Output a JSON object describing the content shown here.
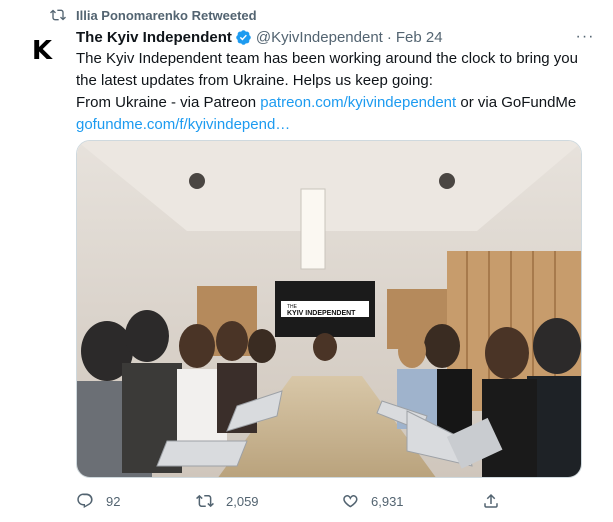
{
  "retweet": {
    "label": "Illia Ponomarenko Retweeted",
    "icon": "retweet-icon"
  },
  "avatar": {
    "letter": "K"
  },
  "tweet": {
    "author_name": "The Kyiv Independent",
    "verified": true,
    "handle": "@KyivIndependent",
    "separator": "·",
    "date": "Feb 24",
    "more_label": "···",
    "line1": "The Kyiv Independent team has been working around the clock to bring you",
    "line2": "the latest updates from Ukraine. Helps us keep going:",
    "line3_prefix": "From Ukraine - via Patreon ",
    "link_patreon": "patreon.com/kyivindependent",
    "line3_mid": " or via GoFundMe",
    "link_gofundme": "gofundme.com/f/kyivindepend…"
  },
  "media": {
    "screen_text_small": "THE",
    "screen_text": "KYIV INDEPENDENT"
  },
  "actions": {
    "replies": "92",
    "retweets": "2,059",
    "likes": "6,931"
  },
  "colors": {
    "link": "#1d9bf0",
    "muted": "#536471",
    "verified": "#1d9bf0"
  }
}
